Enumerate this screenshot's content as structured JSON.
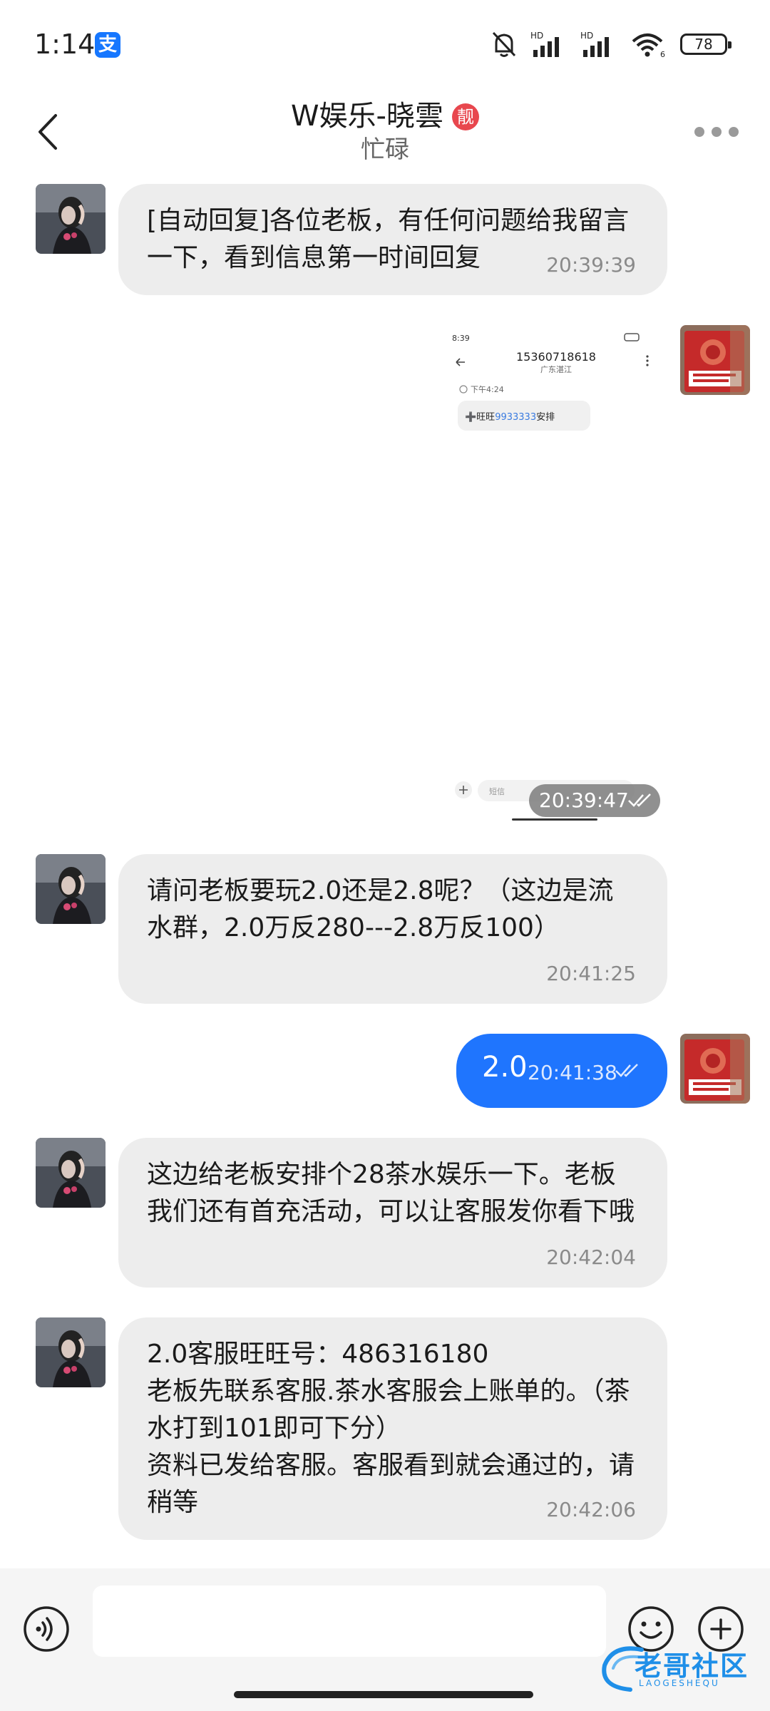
{
  "status_bar": {
    "time": "1:14",
    "app_icon": "支",
    "net1": "HD",
    "net2": "HD",
    "wifi_sub": "6",
    "battery": "78"
  },
  "header": {
    "back_icon": "chevron-left-icon",
    "title": "W娱乐-晓雲",
    "badge": "靓",
    "subtitle": "忙碌",
    "more_icon": "more-horizontal-icon"
  },
  "messages": [
    {
      "side": "left",
      "text": "[自动回复]各位老板，有任何问题给我留言一下，看到信息第一时间回复",
      "time": "20:39:39"
    },
    {
      "side": "right",
      "type": "image",
      "time": "20:39:47",
      "screenshot": {
        "status_time": "8:39",
        "phone_number": "15360718618",
        "location": "广东湛江",
        "msg_time": "下午4:24",
        "msg_prefix": "➕旺旺",
        "msg_number": "9933333",
        "msg_suffix": "安排",
        "input_placeholder": "短信"
      }
    },
    {
      "side": "left",
      "text": "请问老板要玩2.0还是2.8呢？（这边是流水群，2.0万反280---2.8万反100）",
      "time": "20:41:25"
    },
    {
      "side": "right",
      "text": "2.0",
      "time": "20:41:38"
    },
    {
      "side": "left",
      "text": "这边给老板安排个28茶水娱乐一下。老板我们还有首充活动，可以让客服发你看下哦",
      "time": "20:42:04"
    },
    {
      "side": "left",
      "text": "2.0客服旺旺号：486316180\n老板先联系客服.茶水客服会上账单的。（茶水打到101即可下分）\n资料已发给客服。客服看到就会通过的，请稍等",
      "time": "20:42:06"
    }
  ],
  "input_bar": {
    "voice_icon": "voice-icon",
    "emoji_icon": "emoji-icon",
    "plus_icon": "plus-circle-icon"
  },
  "watermark": {
    "text": "老哥社区",
    "sub": "LAOGESHEQU"
  },
  "colors": {
    "accent_blue": "#1f75fe",
    "bubble_gray": "#ededed",
    "badge_red": "#e8474e"
  }
}
